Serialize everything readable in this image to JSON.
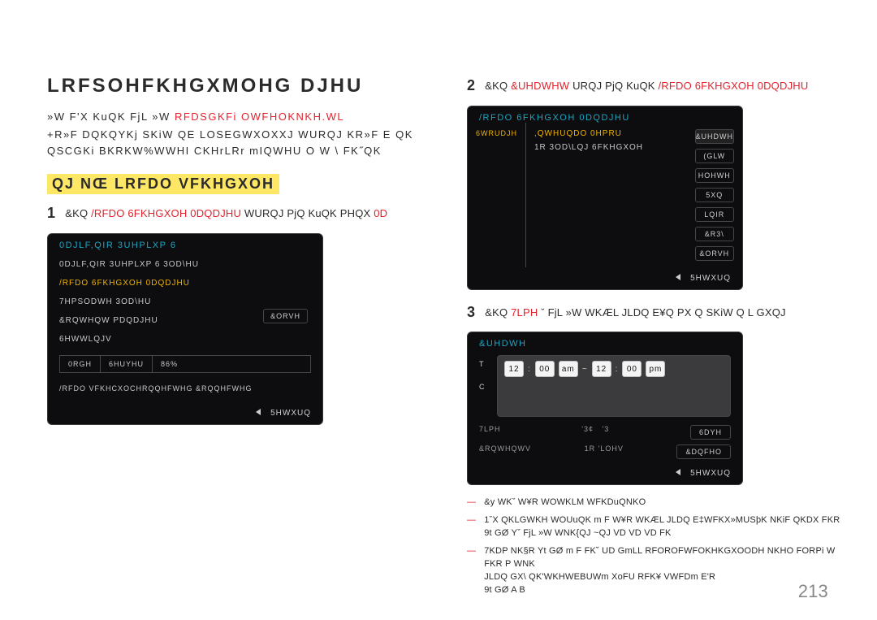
{
  "title": "LRFSOHFKHGXMOHG DJHU",
  "intro1_pre": "»W F'X KuQK FjL  »W",
  "intro1_red": "RFDSGKFi  OWFHOKNKH.WL",
  "intro2": "+R»F DQKQYKj SKiW QE LOSEGWXOXXJ WURQJ KR»F E  QK QSCGKi BKRKW%WWHI CKHrLRr mIQWHU O    W \\ FK˝QK",
  "section_title": "QJ NŒ LRFDO VFKHGXOH",
  "step1_pre": "&KQ",
  "step1_red1": "/RFDO  6FKHGXOH  0DQDJHU",
  "step1_mid": "WURQJ PjQ KuQK PHQX",
  "step1_red2": "0D",
  "step2_pre": "&KQ",
  "step2_red1": "&UHDWHW",
  "step2_mid": "URQJ PjQ KuQK",
  "step2_red2": "/RFDO  6FKHGXOH  0DQDJHU",
  "step3_pre": "&KQ",
  "step3_red1": "7LPH",
  "step3_rest": "ˇ FjL  »W WKÆL JLDQ E¥Q PX Q SKiW Q L GXQJ",
  "panel_menu": {
    "title": "0DJLF,QIR  3UHPLXP 6",
    "row0": "0DJLF,QIR 3UHPLXP 6 3OD\\HU",
    "row1": "/RFDO 6FKHGXOH 0DQDJHU",
    "row2": "7HPSODWH 3OD\\HU",
    "row3": "&RQWHQW PDQDJHU",
    "row4": "6HWWLQJV",
    "close": "&ORVH",
    "status_mode": "0RGH",
    "status_server": "6HUYHU",
    "status_86": "86%",
    "status_line": "/RFDO VFKHCXOCHRQQHFWHG &RQQHFWHG",
    "return": "5HWXUQ"
  },
  "panel_lsm": {
    "title": "/RFDO 6FKHGXOH 0DQDJHU",
    "left_label": "6WRUDJH",
    "mid_label": ",QWHUQDO 0HPRU",
    "mid_text": "1R 3OD\\LQJ 6FKHGXOH",
    "btn_create": "&UHDWH",
    "btn_edit": "(GLW",
    "btn_delete": "HOHWH",
    "btn_unknown": "5XQ",
    "btn_unknown2": "LQIR",
    "btn_unknown3": "&R3\\",
    "close": "&ORVH",
    "return": "5HWXUQ"
  },
  "panel_create": {
    "title": "&UHDWH",
    "strip_t": "T",
    "strip_c": "C",
    "h1": "12",
    "m1": "00",
    "ap1": "am",
    "tilde": "~",
    "h2": "12",
    "m2": "00",
    "ap2": "pm",
    "bl_time": "7LPH",
    "bl_time_r1": "'3¢",
    "bl_time_r2": "'3",
    "bl_content": "&RQWHQWV",
    "bl_content_r": "1R 'LOHV",
    "btn_save": "6DYH",
    "btn_cancel": "&DQFHO",
    "return": "5HWXUQ"
  },
  "bullets": {
    "b1": "&y WKˇ W¥R WOWKLM WFKDuQNKO",
    "b2_a": "1ˇX QKLGWKH WOUuQK  m F W¥R  WKÆL JLDQ E‡WFKX»MUSþK NKiF QKDX FKR",
    "b2_b": "9t GØ  Yˇ FjL  »W WNK{QJ  ~QJ      VD        VD        VD         FK",
    "b3_a": "7KDP NK§R Yt GØ  m F FK˘ UD GmLL RFOROFWFOKHKGXOODH NKHO FORPi W FKR P WNK",
    "b3_b": "JLDQ GX\\ QK'WKHWEBUWm XoFU RFK¥ VWFDm E'R",
    "b3_c": "9t GØ  A                B"
  },
  "page_number": "213"
}
